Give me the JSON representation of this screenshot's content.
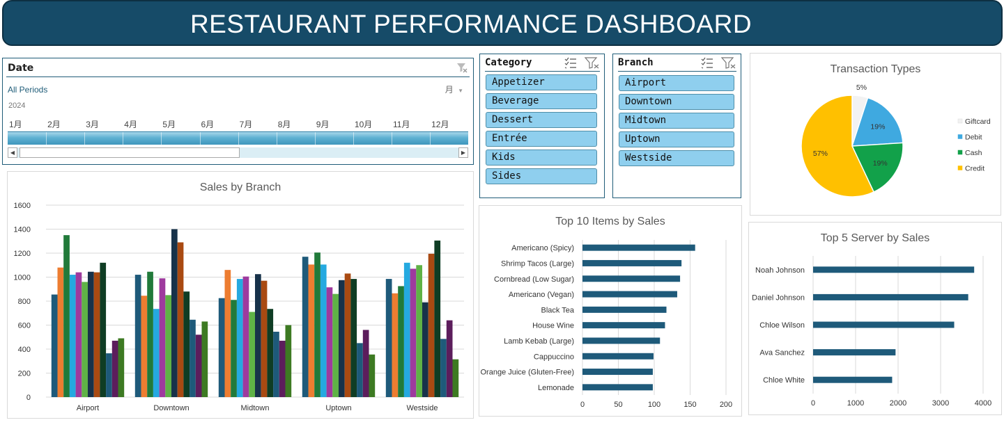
{
  "dashboard": {
    "title": "RESTAURANT PERFORMANCE DASHBOARD"
  },
  "timeline": {
    "header": "Date",
    "periods_label": "All Periods",
    "level_label": "月",
    "year": "2024",
    "months": [
      "1月",
      "2月",
      "3月",
      "4月",
      "5月",
      "6月",
      "7月",
      "8月",
      "9月",
      "10月",
      "11月",
      "12月"
    ]
  },
  "category_slicer": {
    "header": "Category",
    "items": [
      "Appetizer",
      "Beverage",
      "Dessert",
      "Entrée",
      "Kids",
      "Sides"
    ]
  },
  "branch_slicer": {
    "header": "Branch",
    "items": [
      "Airport",
      "Downtown",
      "Midtown",
      "Uptown",
      "Westside"
    ]
  },
  "colors": {
    "banner": "#164b68",
    "bar": "#1e5a7a",
    "slicer_item": "#8fcfee"
  },
  "chart_data": [
    {
      "type": "bar",
      "title": "Sales by Branch",
      "categories": [
        "Airport",
        "Downtown",
        "Midtown",
        "Uptown",
        "Westside"
      ],
      "series": [
        {
          "color": "#1e5a7a",
          "values": [
            855,
            1020,
            825,
            1170,
            985
          ]
        },
        {
          "color": "#ed7d31",
          "values": [
            1080,
            845,
            1060,
            1105,
            865
          ]
        },
        {
          "color": "#217a3a",
          "values": [
            1350,
            1045,
            810,
            1205,
            925
          ]
        },
        {
          "color": "#25a9e0",
          "values": [
            1020,
            735,
            985,
            1105,
            1120
          ]
        },
        {
          "color": "#9e3a9e",
          "values": [
            1040,
            990,
            1005,
            915,
            1070
          ]
        },
        {
          "color": "#5fb246",
          "values": [
            960,
            850,
            710,
            860,
            1100
          ]
        },
        {
          "color": "#17324a",
          "values": [
            1045,
            1400,
            1025,
            975,
            790
          ]
        },
        {
          "color": "#a94a12",
          "values": [
            1040,
            1290,
            970,
            1030,
            1195
          ]
        },
        {
          "color": "#0f3d24",
          "values": [
            1120,
            880,
            735,
            985,
            1305
          ]
        },
        {
          "color": "#1e5a7a",
          "values": [
            365,
            645,
            545,
            450,
            485
          ]
        },
        {
          "color": "#5c1d5c",
          "values": [
            470,
            520,
            470,
            560,
            640
          ]
        },
        {
          "color": "#3d7a22",
          "values": [
            490,
            630,
            600,
            355,
            315
          ]
        }
      ],
      "ylim": [
        0,
        1600
      ],
      "yticks": [
        0,
        200,
        400,
        600,
        800,
        1000,
        1200,
        1400,
        1600
      ],
      "grid": true
    },
    {
      "type": "bar",
      "orientation": "horizontal",
      "title": "Top 10 Items by Sales",
      "categories": [
        "Americano (Spicy)",
        "Shrimp Tacos (Large)",
        "Cornbread (Low Sugar)",
        "Americano (Vegan)",
        "Black Tea",
        "House Wine",
        "Lamb Kebab (Large)",
        "Cappuccino",
        "Orange Juice (Gluten-Free)",
        "Lemonade"
      ],
      "values": [
        157,
        138,
        136,
        132,
        117,
        115,
        108,
        99,
        98,
        98
      ],
      "xlim": [
        0,
        200
      ],
      "xticks": [
        0,
        50,
        100,
        150,
        200
      ],
      "grid": true
    },
    {
      "type": "pie",
      "title": "Transaction Types",
      "slices": [
        {
          "label": "Giftcard",
          "value": 5,
          "text": "5%",
          "color": "#f2f2f2"
        },
        {
          "label": "Debit",
          "value": 19,
          "text": "19%",
          "color": "#3fa9e0"
        },
        {
          "label": "Cash",
          "value": 19,
          "text": "19%",
          "color": "#12a14a"
        },
        {
          "label": "Credit",
          "value": 57,
          "text": "57%",
          "color": "#ffc000"
        }
      ],
      "legend": "right"
    },
    {
      "type": "bar",
      "orientation": "horizontal",
      "title": "Top 5 Server by Sales",
      "categories": [
        "Noah Johnson",
        "Daniel Johnson",
        "Chloe Wilson",
        "Ava Sanchez",
        "Chloe White"
      ],
      "values": [
        3790,
        3650,
        3320,
        1940,
        1860
      ],
      "xlim": [
        0,
        4000
      ],
      "xticks": [
        0,
        1000,
        2000,
        3000,
        4000
      ],
      "grid": true
    }
  ]
}
